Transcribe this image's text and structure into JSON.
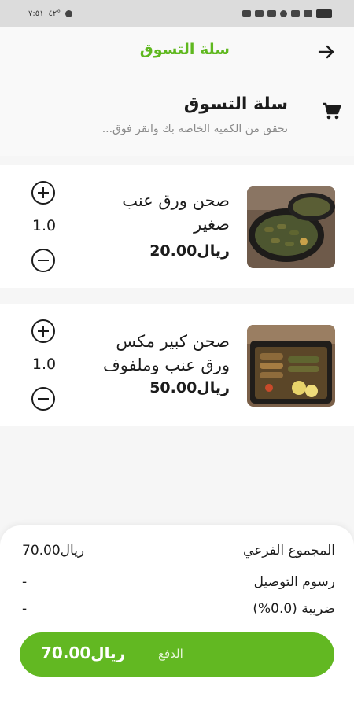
{
  "status_bar": {
    "time": "٧:٥١",
    "temp": "٤٢°"
  },
  "app_bar": {
    "title": "سلة التسوق"
  },
  "header": {
    "title": "سلة التسوق",
    "subtitle": "تحقق من الكمية الخاصة بك وانقر فوق..."
  },
  "items": [
    {
      "name": "صحن ورق عنب صغير",
      "price": "ريال20.00",
      "qty": "1.0"
    },
    {
      "name": "صحن كبير مكس ورق عنب وملفوف",
      "price": "ريال50.00",
      "qty": "1.0"
    }
  ],
  "summary": {
    "subtotal_label": "المجموع الفرعي",
    "subtotal_value": "ريال70.00",
    "delivery_label": "رسوم التوصيل",
    "delivery_value": "-",
    "tax_label": "ضريبة (0.0%)",
    "tax_value": "-"
  },
  "pay": {
    "label": "الدفع",
    "total": "ريال70.00"
  },
  "colors": {
    "accent": "#62b822",
    "title_green": "#5fb81f"
  },
  "icons": {
    "back": "arrow-right-icon",
    "cart": "shopping-cart-icon",
    "plus": "plus-circle-icon",
    "minus": "minus-circle-icon"
  }
}
